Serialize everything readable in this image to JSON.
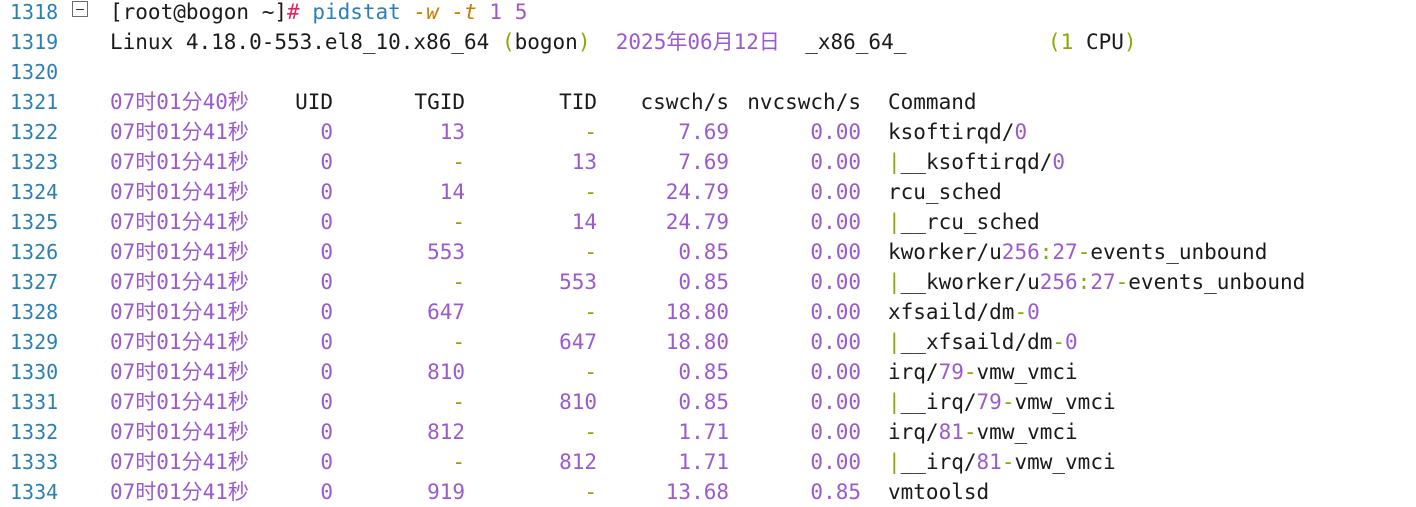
{
  "lines": [
    {
      "n": "1318",
      "type": "prompt",
      "prompt": "[root@bogon ~]",
      "hash": "#",
      "cmd": "pidstat",
      "flag1": "-w",
      "flag2": "-t",
      "arg1": "1",
      "arg2": "5"
    },
    {
      "n": "1319",
      "type": "sysinfo",
      "os": "Linux 4.18.0-553.el8_10.x86_64 ",
      "host_open": "(",
      "host": "bogon",
      "host_close": ")",
      "date": "2025年06月12日",
      "arch": "_x86_64_",
      "cpu_open": "(",
      "cpu_num": "1",
      "cpu_label": " CPU",
      "cpu_close": ")"
    },
    {
      "n": "1320",
      "type": "blank"
    },
    {
      "n": "1321",
      "type": "header",
      "time": "07时01分40秒",
      "uid": "UID",
      "tgid": "TGID",
      "tid": "TID",
      "cswch": "cswch/s",
      "nvcswch": "nvcswch/s",
      "command": "Command"
    },
    {
      "n": "1322",
      "type": "row",
      "time": "07时01分41秒",
      "uid": "0",
      "tgid": "13",
      "tid": "-",
      "cswch": "7.69",
      "nvcswch": "0.00",
      "command": "ksoftirqd/0"
    },
    {
      "n": "1323",
      "type": "row",
      "time": "07时01分41秒",
      "uid": "0",
      "tgid": "-",
      "tid": "13",
      "cswch": "7.69",
      "nvcswch": "0.00",
      "command": "|__ksoftirqd/0"
    },
    {
      "n": "1324",
      "type": "row",
      "time": "07时01分41秒",
      "uid": "0",
      "tgid": "14",
      "tid": "-",
      "cswch": "24.79",
      "nvcswch": "0.00",
      "command": "rcu_sched"
    },
    {
      "n": "1325",
      "type": "row",
      "time": "07时01分41秒",
      "uid": "0",
      "tgid": "-",
      "tid": "14",
      "cswch": "24.79",
      "nvcswch": "0.00",
      "command": "|__rcu_sched"
    },
    {
      "n": "1326",
      "type": "row",
      "time": "07时01分41秒",
      "uid": "0",
      "tgid": "553",
      "tid": "-",
      "cswch": "0.85",
      "nvcswch": "0.00",
      "command": "kworker/u256:27-events_unbound"
    },
    {
      "n": "1327",
      "type": "row",
      "time": "07时01分41秒",
      "uid": "0",
      "tgid": "-",
      "tid": "553",
      "cswch": "0.85",
      "nvcswch": "0.00",
      "command": "|__kworker/u256:27-events_unbound"
    },
    {
      "n": "1328",
      "type": "row",
      "time": "07时01分41秒",
      "uid": "0",
      "tgid": "647",
      "tid": "-",
      "cswch": "18.80",
      "nvcswch": "0.00",
      "command": "xfsaild/dm-0"
    },
    {
      "n": "1329",
      "type": "row",
      "time": "07时01分41秒",
      "uid": "0",
      "tgid": "-",
      "tid": "647",
      "cswch": "18.80",
      "nvcswch": "0.00",
      "command": "|__xfsaild/dm-0"
    },
    {
      "n": "1330",
      "type": "row",
      "time": "07时01分41秒",
      "uid": "0",
      "tgid": "810",
      "tid": "-",
      "cswch": "0.85",
      "nvcswch": "0.00",
      "command": "irq/79-vmw_vmci"
    },
    {
      "n": "1331",
      "type": "row",
      "time": "07时01分41秒",
      "uid": "0",
      "tgid": "-",
      "tid": "810",
      "cswch": "0.85",
      "nvcswch": "0.00",
      "command": "|__irq/79-vmw_vmci"
    },
    {
      "n": "1332",
      "type": "row",
      "time": "07时01分41秒",
      "uid": "0",
      "tgid": "812",
      "tid": "-",
      "cswch": "1.71",
      "nvcswch": "0.00",
      "command": "irq/81-vmw_vmci"
    },
    {
      "n": "1333",
      "type": "row",
      "time": "07时01分41秒",
      "uid": "0",
      "tgid": "-",
      "tid": "812",
      "cswch": "1.71",
      "nvcswch": "0.00",
      "command": "|__irq/81-vmw_vmci"
    },
    {
      "n": "1334",
      "type": "row",
      "time": "07时01分41秒",
      "uid": "0",
      "tgid": "919",
      "tid": "-",
      "cswch": "13.68",
      "nvcswch": "0.85",
      "command": "vmtoolsd"
    }
  ]
}
